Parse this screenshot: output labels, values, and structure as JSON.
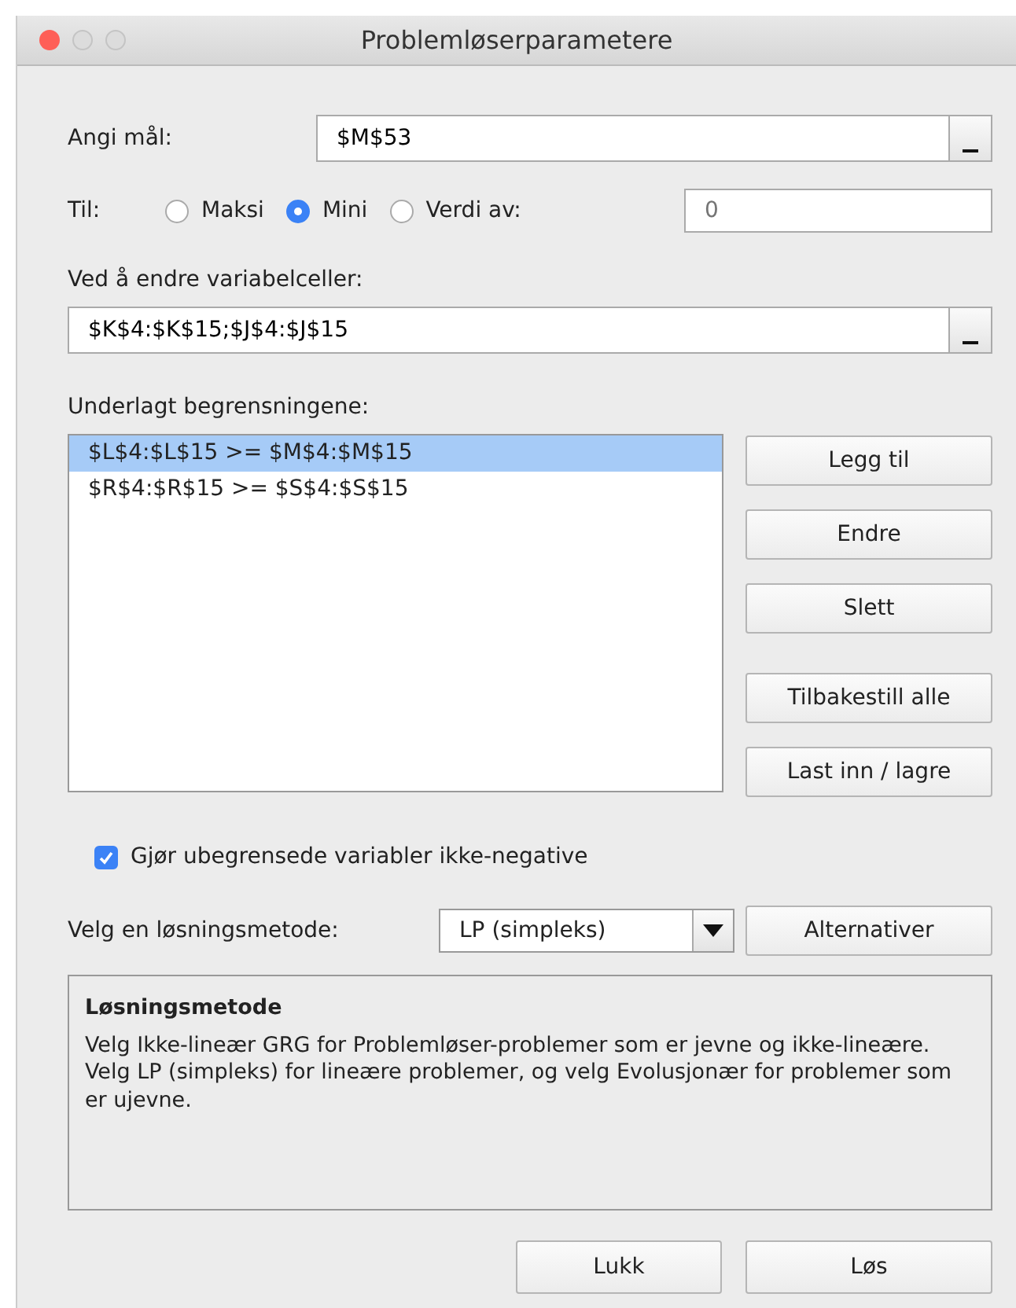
{
  "window": {
    "title": "Problemløserparametere"
  },
  "target": {
    "label": "Angi mål:",
    "value": "$M$53"
  },
  "to": {
    "label": "Til:",
    "options": [
      {
        "label": "Maksi",
        "selected": false
      },
      {
        "label": "Mini",
        "selected": true
      },
      {
        "label": "Verdi av:",
        "selected": false
      }
    ],
    "value_placeholder": "0"
  },
  "variables": {
    "label": "Ved å endre variabelceller:",
    "value": "$K$4:$K$15;$J$4:$J$15"
  },
  "constraints": {
    "label": "Underlagt begrensningene:",
    "items": [
      {
        "text": "$L$4:$L$15 >= $M$4:$M$15",
        "selected": true
      },
      {
        "text": "$R$4:$R$15 >= $S$4:$S$15",
        "selected": false
      }
    ],
    "buttons": [
      "Legg til",
      "Endre",
      "Slett",
      "Tilbakestill alle",
      "Last inn / lagre"
    ]
  },
  "nonnegative": {
    "label": "Gjør ubegrensede variabler ikke-negative",
    "checked": true
  },
  "method": {
    "label": "Velg en løsningsmetode:",
    "value": "LP (simpleks)",
    "button": "Alternativer"
  },
  "description": {
    "title": "Løsningsmetode",
    "text": "Velg Ikke-lineær GRG for Problemløser-problemer som er jevne og ikke-lineære. Velg LP (simpleks) for lineære problemer, og velg Evolusjonær for problemer som er ujevne."
  },
  "footer_buttons": [
    "Lukk",
    "Løs"
  ]
}
